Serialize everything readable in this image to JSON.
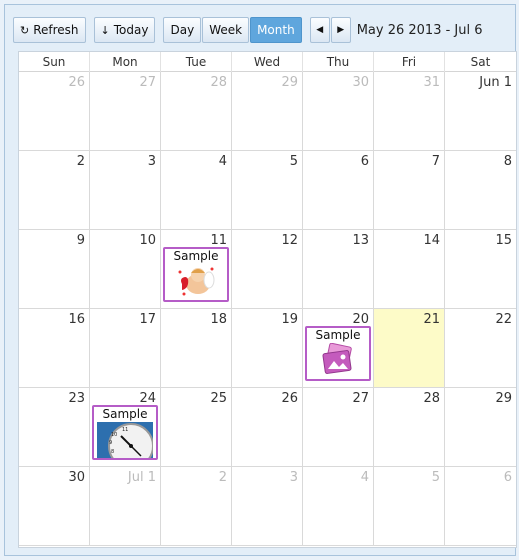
{
  "toolbar": {
    "refresh_label": "Refresh",
    "today_label": "Today",
    "views": [
      "Day",
      "Week",
      "Month"
    ],
    "active_view": "Month",
    "prev_icon": "caret-left-icon",
    "next_icon": "caret-right-icon",
    "date_range": "May 26 2013 - Jul 6"
  },
  "weekdays": [
    "Sun",
    "Mon",
    "Tue",
    "Wed",
    "Thu",
    "Fri",
    "Sat"
  ],
  "weeks": [
    [
      "26",
      "27",
      "28",
      "29",
      "30",
      "31",
      "Jun 1"
    ],
    [
      "2",
      "3",
      "4",
      "5",
      "6",
      "7",
      "8"
    ],
    [
      "9",
      "10",
      "11",
      "12",
      "13",
      "14",
      "15"
    ],
    [
      "16",
      "17",
      "18",
      "19",
      "20",
      "21",
      "22"
    ],
    [
      "23",
      "24",
      "25",
      "26",
      "27",
      "28",
      "29"
    ],
    [
      "30",
      "Jul 1",
      "2",
      "3",
      "4",
      "5",
      "6"
    ]
  ],
  "today": "21",
  "events": [
    {
      "date": "11",
      "title": "Sample",
      "image": "cupid-angel-icon"
    },
    {
      "date": "20",
      "title": "Sample",
      "image": "photo-gallery-icon"
    },
    {
      "date": "24",
      "title": "Sample",
      "image": "clock-icon"
    }
  ],
  "colors": {
    "active_button": "#5fa6dd",
    "event_border": "#b55cc7",
    "today_highlight": "#fdfbc8",
    "other_month_text": "#bbbbbb"
  }
}
